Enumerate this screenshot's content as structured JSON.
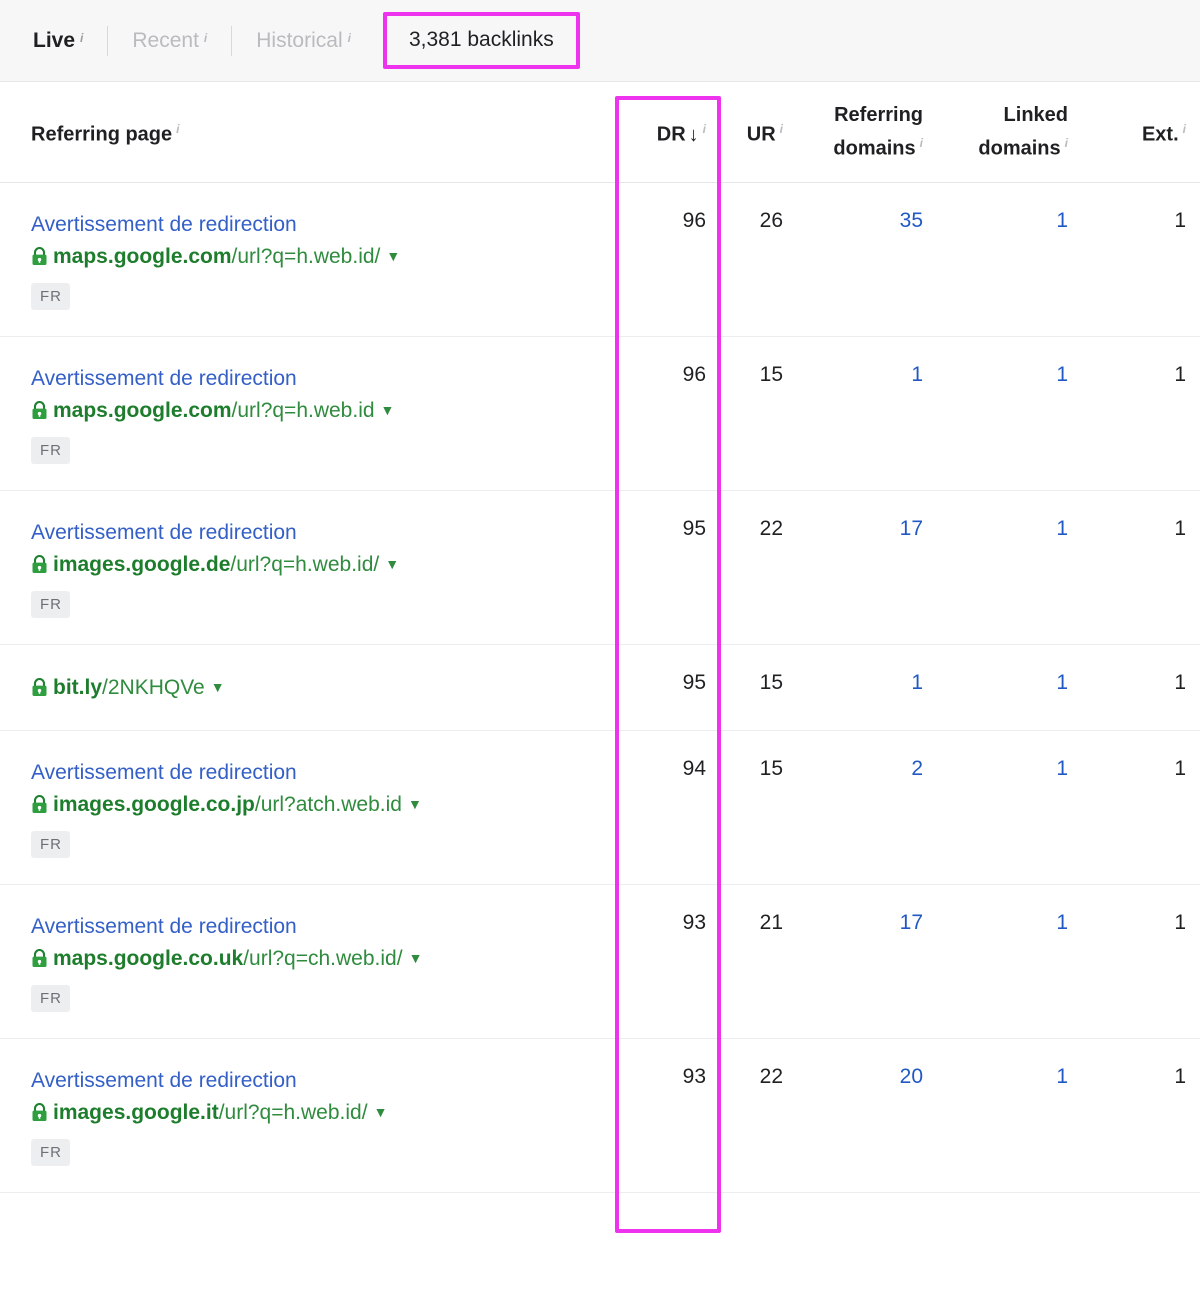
{
  "header": {
    "tabs": [
      {
        "label": "Live",
        "info": "i",
        "active": true
      },
      {
        "label": "Recent",
        "info": "i",
        "active": false
      },
      {
        "label": "Historical",
        "info": "i",
        "active": false
      }
    ],
    "backlinks_count": "3,381 backlinks",
    "highlight_color": "#ee33ee"
  },
  "table": {
    "columns": [
      {
        "label": "Referring page",
        "info": "i",
        "align": "left"
      },
      {
        "label": "DR",
        "info": "i",
        "align": "right",
        "sorted": true,
        "sort_dir": "desc",
        "sort_glyph": "↓"
      },
      {
        "label": "UR",
        "info": "i",
        "align": "right"
      },
      {
        "label": "Referring domains",
        "info": "i",
        "align": "right"
      },
      {
        "label": "Linked domains",
        "info": "i",
        "align": "right"
      },
      {
        "label": "Ext.",
        "info": "i",
        "align": "right"
      }
    ],
    "rows": [
      {
        "title": "Avertissement de redirection",
        "url_host": "maps.google.com",
        "url_path": "/url?q=h.web.id/",
        "secure": true,
        "lang_badge": "FR",
        "dr": "96",
        "ur": "26",
        "referring_domains": "35",
        "referring_domains_link": true,
        "linked_domains": "1",
        "linked_domains_link": true,
        "ext": "1",
        "ext_link": false
      },
      {
        "title": "Avertissement de redirection",
        "url_host": "maps.google.com",
        "url_path": "/url?q=h.web.id",
        "secure": true,
        "lang_badge": "FR",
        "dr": "96",
        "ur": "15",
        "referring_domains": "1",
        "referring_domains_link": true,
        "linked_domains": "1",
        "linked_domains_link": true,
        "ext": "1",
        "ext_link": false
      },
      {
        "title": "Avertissement de redirection",
        "url_host": "images.google.de",
        "url_path": "/url?q=h.web.id/",
        "secure": true,
        "lang_badge": "FR",
        "dr": "95",
        "ur": "22",
        "referring_domains": "17",
        "referring_domains_link": true,
        "linked_domains": "1",
        "linked_domains_link": true,
        "ext": "1",
        "ext_link": false
      },
      {
        "title": "",
        "url_host": "bit.ly",
        "url_path": "/2NKHQVe",
        "secure": true,
        "lang_badge": "",
        "dr": "95",
        "ur": "15",
        "referring_domains": "1",
        "referring_domains_link": true,
        "linked_domains": "1",
        "linked_domains_link": true,
        "ext": "1",
        "ext_link": false
      },
      {
        "title": "Avertissement de redirection",
        "url_host": "images.google.co.jp",
        "url_path": "/url?atch.web.id",
        "secure": true,
        "lang_badge": "FR",
        "dr": "94",
        "ur": "15",
        "referring_domains": "2",
        "referring_domains_link": true,
        "linked_domains": "1",
        "linked_domains_link": true,
        "ext": "1",
        "ext_link": false
      },
      {
        "title": "Avertissement de redirection",
        "url_host": "maps.google.co.uk",
        "url_path": "/url?q=ch.web.id/",
        "secure": true,
        "lang_badge": "FR",
        "dr": "93",
        "ur": "21",
        "referring_domains": "17",
        "referring_domains_link": true,
        "linked_domains": "1",
        "linked_domains_link": true,
        "ext": "1",
        "ext_link": false
      },
      {
        "title": "Avertissement de redirection",
        "url_host": "images.google.it",
        "url_path": "/url?q=h.web.id/",
        "secure": true,
        "lang_badge": "FR",
        "dr": "93",
        "ur": "22",
        "referring_domains": "20",
        "referring_domains_link": true,
        "linked_domains": "1",
        "linked_domains_link": true,
        "ext": "1",
        "ext_link": false
      }
    ]
  },
  "icons": {
    "lock": "lock-icon",
    "caret": "▼",
    "sort_down": "↓"
  },
  "colors": {
    "link_blue": "#335fc7",
    "number_link_blue": "#2159c4",
    "url_green": "#2f8b3d",
    "highlight_magenta": "#ee33ee",
    "text_dark": "#1f2022",
    "muted_gray": "#b9bbbe"
  }
}
